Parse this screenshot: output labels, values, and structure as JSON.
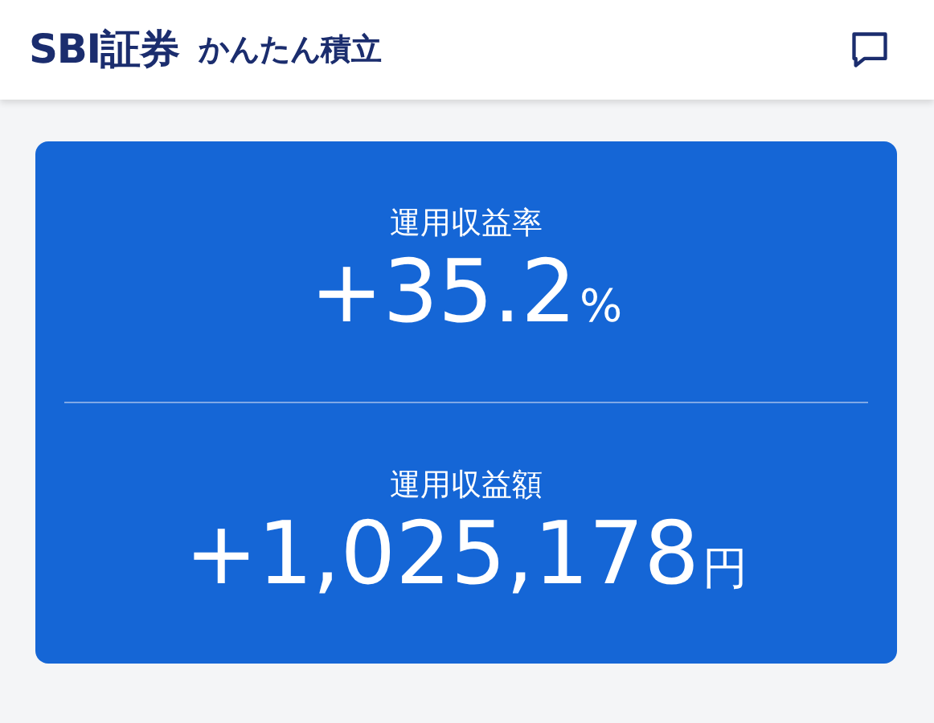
{
  "header": {
    "logo": "SBI証券",
    "title": "かんたん積立"
  },
  "metrics": [
    {
      "label": "運用収益率",
      "value": "+35.2",
      "unit": "%"
    },
    {
      "label": "運用収益額",
      "value": "+1,025,178",
      "unit": "円"
    }
  ]
}
